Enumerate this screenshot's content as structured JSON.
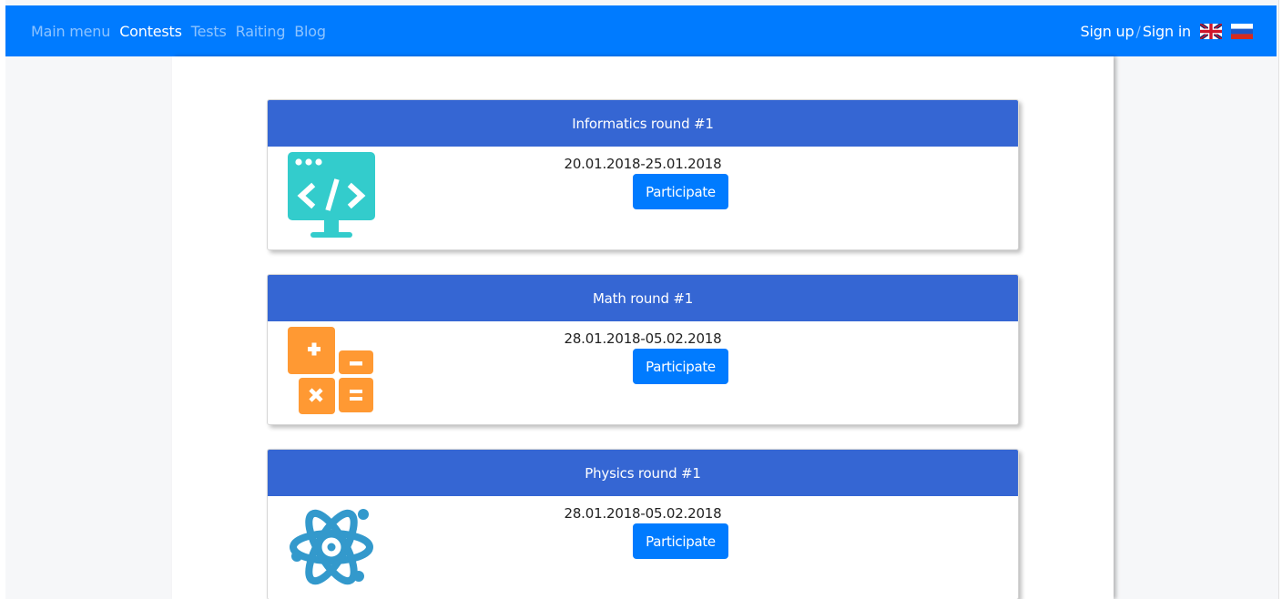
{
  "nav": {
    "items": [
      {
        "label": "Main menu"
      },
      {
        "label": "Contests"
      },
      {
        "label": "Tests"
      },
      {
        "label": "Raiting"
      },
      {
        "label": "Blog"
      }
    ],
    "active": "Contests",
    "sign_up": "Sign up",
    "separator": "/",
    "sign_in": "Sign in",
    "languages": [
      "en-flag-icon",
      "ru-flag-icon"
    ]
  },
  "colors": {
    "navbar": "#007bff",
    "card_header": "#3566d3",
    "button": "#007bff",
    "informatics_icon": "#33cccc",
    "math_icon": "#ff9933",
    "physics_icon": "#3399cc"
  },
  "contests": [
    {
      "title": "Informatics round #1",
      "dates": "20.01.2018-25.01.2018",
      "button": "Participate",
      "icon": "code-monitor-icon"
    },
    {
      "title": "Math round #1",
      "dates": "28.01.2018-05.02.2018",
      "button": "Participate",
      "icon": "calculator-icon"
    },
    {
      "title": "Physics round #1",
      "dates": "28.01.2018-05.02.2018",
      "button": "Participate",
      "icon": "atom-icon"
    }
  ]
}
